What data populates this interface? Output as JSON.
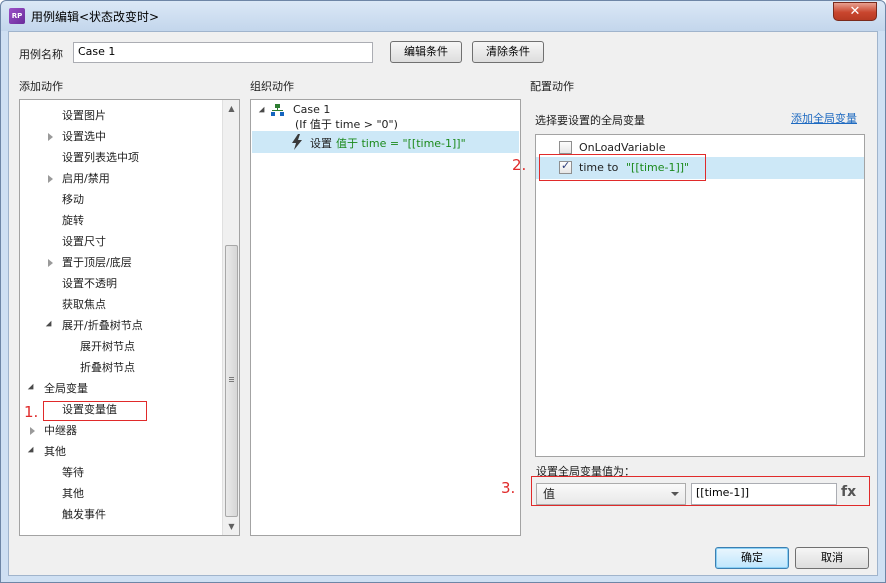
{
  "window": {
    "title": "用例编辑<状态改变时>",
    "app_icon_text": "RP",
    "close_glyph": "✕"
  },
  "case_name": {
    "label": "用例名称",
    "value": "Case 1"
  },
  "buttons": {
    "edit_condition": "编辑条件",
    "clear_condition": "清除条件",
    "ok": "确定",
    "cancel": "取消"
  },
  "sections": {
    "add_action": "添加动作",
    "organize_action": "组织动作",
    "configure_action": "配置动作"
  },
  "add_action_tree": [
    {
      "label": "设置图片",
      "indent": 2,
      "expander": "none"
    },
    {
      "label": "设置选中",
      "indent": 2,
      "expander": "collapsed"
    },
    {
      "label": "设置列表选中项",
      "indent": 2,
      "expander": "none"
    },
    {
      "label": "启用/禁用",
      "indent": 2,
      "expander": "collapsed"
    },
    {
      "label": "移动",
      "indent": 2,
      "expander": "none"
    },
    {
      "label": "旋转",
      "indent": 2,
      "expander": "none"
    },
    {
      "label": "设置尺寸",
      "indent": 2,
      "expander": "none"
    },
    {
      "label": "置于顶层/底层",
      "indent": 2,
      "expander": "collapsed"
    },
    {
      "label": "设置不透明",
      "indent": 2,
      "expander": "none"
    },
    {
      "label": "获取焦点",
      "indent": 2,
      "expander": "none"
    },
    {
      "label": "展开/折叠树节点",
      "indent": 2,
      "expander": "expanded"
    },
    {
      "label": "展开树节点",
      "indent": 3,
      "expander": "none"
    },
    {
      "label": "折叠树节点",
      "indent": 3,
      "expander": "none"
    },
    {
      "label": "全局变量",
      "indent": 1,
      "expander": "expanded"
    },
    {
      "label": "设置变量值",
      "indent": 2,
      "expander": "none"
    },
    {
      "label": "中继器",
      "indent": 1,
      "expander": "collapsed"
    },
    {
      "label": "其他",
      "indent": 1,
      "expander": "expanded"
    },
    {
      "label": "等待",
      "indent": 2,
      "expander": "none"
    },
    {
      "label": "其他",
      "indent": 2,
      "expander": "none"
    },
    {
      "label": "触发事件",
      "indent": 2,
      "expander": "none"
    }
  ],
  "organize": {
    "case_title": "Case 1",
    "case_condition": "(If 值于 time > \"0\")",
    "action_prefix": "设置",
    "action_detail": "值于 time = \"[[time-1]]\""
  },
  "configure": {
    "select_var_label": "选择要设置的全局变量",
    "add_var_link": "添加全局变量",
    "variables": [
      {
        "name": "OnLoadVariable",
        "suffix": "",
        "checked": false,
        "selected": false
      },
      {
        "name": "time to ",
        "suffix": "\"[[time-1]]\"",
        "checked": true,
        "selected": true
      }
    ],
    "set_value_label": "设置全局变量值为：",
    "value_type": "值",
    "value_text": "[[time-1]]",
    "fx_label": "fx"
  },
  "annotations": {
    "one": "1.",
    "two": "2.",
    "three": "3."
  },
  "colors": {
    "annotation": "#e02a2a",
    "selection": "#cde8f7",
    "link": "#1e6ac1",
    "green_text": "#1c8a1c"
  }
}
